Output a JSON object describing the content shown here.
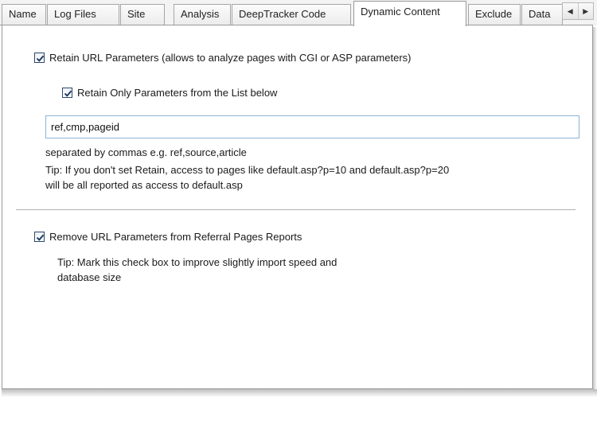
{
  "tabs": [
    {
      "label": "Name"
    },
    {
      "label": "Log Files"
    },
    {
      "label": "Site"
    },
    {
      "label": "Analysis"
    },
    {
      "label": "DeepTracker Code"
    },
    {
      "label": "Dynamic Content",
      "active": true
    },
    {
      "label": "Exclude"
    },
    {
      "label": "Data"
    }
  ],
  "tab_scroll": {
    "left_icon": "arrow-left",
    "right_icon": "arrow-right"
  },
  "retain_params": {
    "checked": true,
    "label": "Retain URL Parameters (allows to analyze pages with CGI or ASP parameters)"
  },
  "retain_only_list": {
    "checked": true,
    "label": "Retain Only Parameters from the List below"
  },
  "params_input": {
    "value": "ref,cmp,pageid"
  },
  "params_hint": "separated by commas e.g. ref,source,article",
  "retain_tip_line1": "Tip: If you don't set Retain, access to pages like default.asp?p=10 and default.asp?p=20",
  "retain_tip_line2": "will be all reported as access to default.asp",
  "remove_params": {
    "checked": true,
    "label": "Remove URL Parameters from Referral Pages Reports"
  },
  "remove_tip_line1": "Tip: Mark this check box to improve slightly import speed and",
  "remove_tip_line2": "database size"
}
